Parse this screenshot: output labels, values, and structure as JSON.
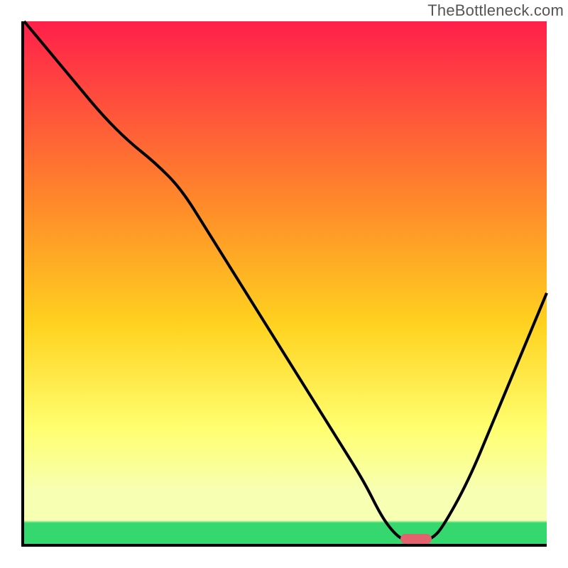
{
  "watermark": "TheBottleneck.com",
  "colors": {
    "gradient_top": "#ff1f4b",
    "gradient_upper_mid": "#ff8a2a",
    "gradient_mid": "#ffd21f",
    "gradient_lower_mid": "#ffff70",
    "gradient_near_bottom": "#f7ffb3",
    "gradient_green_band": "#34d86e",
    "curve": "#000000",
    "axes": "#000000",
    "marker": "#e2636e"
  },
  "chart_data": {
    "type": "line",
    "title": "",
    "xlabel": "",
    "ylabel": "",
    "xlim": [
      0,
      100
    ],
    "ylim": [
      0,
      100
    ],
    "x": [
      0,
      5,
      10,
      15,
      20,
      25,
      30,
      35,
      40,
      45,
      50,
      55,
      60,
      65,
      68,
      70,
      72,
      74,
      76,
      78,
      80,
      85,
      90,
      95,
      100
    ],
    "values": [
      100,
      94,
      88,
      82,
      77,
      73,
      68,
      60,
      52,
      44,
      36,
      28,
      20,
      12,
      6,
      3,
      1,
      0.5,
      0.5,
      1,
      3,
      12,
      24,
      36,
      48
    ],
    "marker": {
      "x_start": 72,
      "x_end": 78,
      "y": 0.6
    },
    "gradient_stops_pct": [
      0,
      35,
      58,
      78,
      90,
      95.5,
      96,
      100
    ],
    "notes": "Axes are unlabeled in the source image; x and y read as 0–100 normalized. Curve descends from top-left, inflects near x≈25, reaches a flat minimum around x≈72–78 near y≈0, then rises to y≈48 at x=100. A short red pill marker sits on the minimum."
  }
}
